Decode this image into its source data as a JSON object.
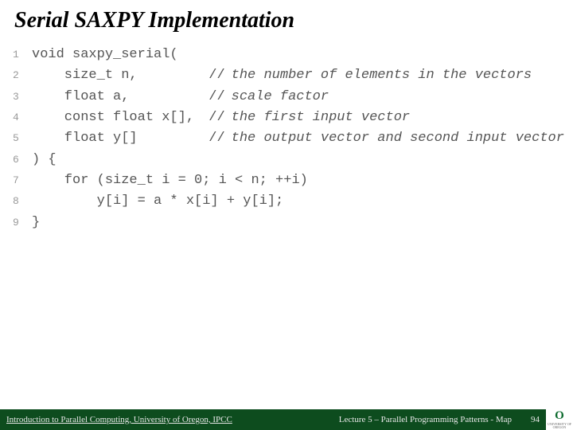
{
  "title": "Serial SAXPY Implementation",
  "code": {
    "lines": [
      {
        "n": "1",
        "code": "void saxpy_serial(",
        "comment": ""
      },
      {
        "n": "2",
        "code": "    size_t n,        ",
        "comment": "the number of elements in the vectors"
      },
      {
        "n": "3",
        "code": "    float a,         ",
        "comment": "scale factor"
      },
      {
        "n": "4",
        "code": "    const float x[], ",
        "comment": "the first input vector"
      },
      {
        "n": "5",
        "code": "    float y[]        ",
        "comment": "the output vector and second input vector"
      },
      {
        "n": "6",
        "code": ") {",
        "comment": ""
      },
      {
        "n": "7",
        "code": "    for (size_t i = 0; i < n; ++i)",
        "comment": ""
      },
      {
        "n": "8",
        "code": "        y[i] = a * x[i] + y[i];",
        "comment": ""
      },
      {
        "n": "9",
        "code": "}",
        "comment": ""
      }
    ]
  },
  "footer": {
    "left": "Introduction to Parallel Computing, University of Oregon, IPCC",
    "center": "Lecture 5 – Parallel Programming Patterns - Map",
    "page": "94"
  },
  "logo": {
    "mark": "O",
    "text": "UNIVERSITY OF OREGON"
  }
}
